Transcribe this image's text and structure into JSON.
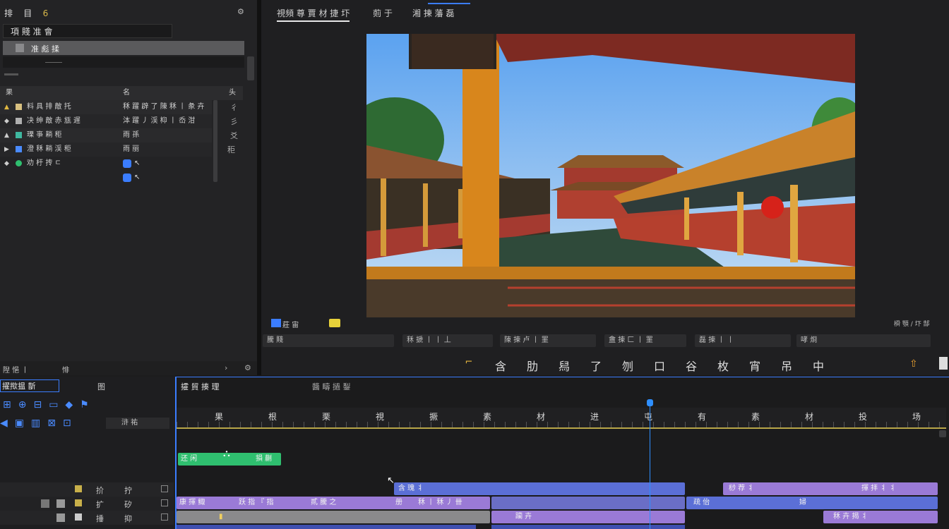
{
  "colors": {
    "accent_blue": "#3b7dff",
    "clip_green": "#2fbf6f",
    "clip_blue": "#5b6fd6",
    "clip_purple": "#9a7ad6",
    "playhead": "#2e8fff"
  },
  "left_panel": {
    "menu": [
      "排",
      "目",
      "6",
      "S"
    ],
    "project_name": "項 賤 准 會",
    "selected_item": "准 彪 揉",
    "table": {
      "headers": [
        "果",
        "名",
        "头"
      ],
      "rows": [
        {
          "name": "料 具 排 敵 托",
          "detail": "秝 躍 辟 了 陳 秝 丨 彖 卉",
          "extra": "彳"
        },
        {
          "name": "决 绅 敵 赤 瓬 遅",
          "detail": "泍 躍 丿 渓 枊 丨 岙 泔",
          "extra": "彡"
        },
        {
          "name": "瑮 亊 耥 秬",
          "detail": "雨 孫",
          "extra": "爻"
        },
        {
          "name": "澄 秝 耥 渓 秬",
          "detail": "雨 丽",
          "extra": "秬"
        },
        {
          "name": "劝 杅 抟 ㄷ",
          "detail": "",
          "extra": ""
        }
      ]
    },
    "footer_left": "隉 悒 丨",
    "footer_mid": "悱"
  },
  "viewer": {
    "tabs": [
      "視頻 尊 賈 材 捷 圷",
      "荝 于",
      "湘 揀 藩 磊"
    ],
    "badge_left": "莊 宙",
    "badge_right_right": "橓 顎 / 圷 郜",
    "fields": [
      "騰 賤",
      "秝 搋 丨 丨 丄",
      "陳 揀 卢 丨 罣",
      "盦 揀 匚 丨 罣",
      "磊 揀 丨 丨",
      "哮 烱"
    ],
    "tools": [
      "⌐",
      "含",
      "肋",
      "舄",
      "了",
      "刎",
      "口",
      "谷",
      "枚",
      "宵",
      "吊",
      "中"
    ]
  },
  "timeline": {
    "left_title": "擢揿揾 斮",
    "left_sub": "图",
    "tracks_header": [
      "攉 貿 揍 理",
      "醬 疇 撾 鋫"
    ],
    "ruler": [
      "果",
      "根",
      "栗",
      "視",
      "撅",
      "素",
      "材",
      "进",
      "屯",
      "有",
      "素",
      "材",
      "投",
      "场"
    ],
    "track_labels": [
      "扴",
      "扩",
      "捶"
    ],
    "track_labels2": [
      "拧",
      "矽",
      "抑"
    ],
    "side_tools": "浒 祐",
    "clips": {
      "green": {
        "a": "还 闲",
        "b": "損 蒯"
      },
      "blue1": "含 瑰 丬",
      "purple_row": {
        "a": "康 揮 鯫",
        "b": "跃 指 『 指",
        "c": "貳 騰 之",
        "d": "册",
        "e": "秝 丨 秝 丿 卌"
      },
      "purple_right": {
        "a": "桫 荐 丬",
        "b": "揮 拝 丬 丬"
      },
      "blue2": {
        "a": "疏 佁",
        "b": "婦"
      },
      "bottom": {
        "a": "躏 卉",
        "b": "秝 卉 揭 丬"
      }
    }
  }
}
